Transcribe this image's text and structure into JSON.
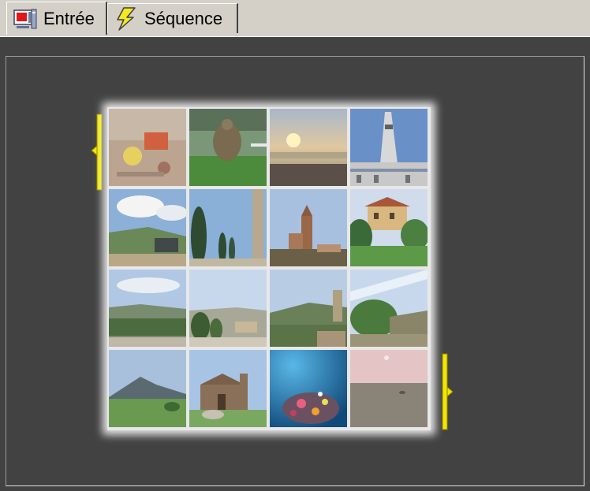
{
  "tabs": [
    {
      "label": "Entrée",
      "icon": "monitor-input-icon",
      "active": true
    },
    {
      "label": "Séquence",
      "icon": "lightning-icon",
      "active": false
    }
  ],
  "colors": {
    "panel_bg": "#424242",
    "marker": "#f2e600",
    "chrome": "#d4d0c8"
  },
  "thumbnails": [
    {
      "row": 0,
      "col": 0,
      "subject": "toy-car-in-sand"
    },
    {
      "row": 0,
      "col": 1,
      "subject": "statue-on-grass"
    },
    {
      "row": 0,
      "col": 2,
      "subject": "sunset-over-sea"
    },
    {
      "row": 0,
      "col": 3,
      "subject": "church-tower"
    },
    {
      "row": 1,
      "col": 0,
      "subject": "hills-with-clouds"
    },
    {
      "row": 1,
      "col": 1,
      "subject": "cypress-trees"
    },
    {
      "row": 1,
      "col": 2,
      "subject": "church-bell-tower"
    },
    {
      "row": 1,
      "col": 3,
      "subject": "villa-on-hill"
    },
    {
      "row": 2,
      "col": 0,
      "subject": "valley-landscape"
    },
    {
      "row": 2,
      "col": 1,
      "subject": "hill-village"
    },
    {
      "row": 2,
      "col": 2,
      "subject": "hilltop-town"
    },
    {
      "row": 2,
      "col": 3,
      "subject": "green-hillside"
    },
    {
      "row": 3,
      "col": 0,
      "subject": "mountain-meadow"
    },
    {
      "row": 3,
      "col": 1,
      "subject": "church-facade"
    },
    {
      "row": 3,
      "col": 2,
      "subject": "coral-reef"
    },
    {
      "row": 3,
      "col": 3,
      "subject": "misty-flat-beach"
    }
  ]
}
